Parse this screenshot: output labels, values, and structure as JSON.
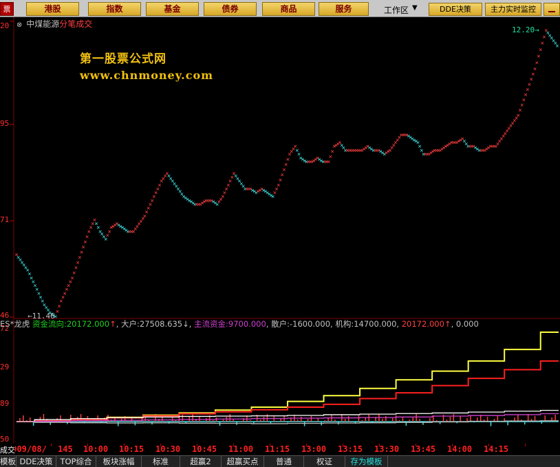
{
  "topbar": {
    "brand": "票",
    "tabs": [
      {
        "label": "港股"
      },
      {
        "label": "指数"
      },
      {
        "label": "基金"
      },
      {
        "label": "债券"
      },
      {
        "label": "商品"
      },
      {
        "label": "服务"
      }
    ],
    "workspace": "工作区",
    "workspace_arrow": "▼",
    "dde_button": "DDE决策",
    "monitor_button": "主力实时监控"
  },
  "main_chart": {
    "stock_name": "中煤能源",
    "chart_mode": "分笔成交",
    "watermark_cn": "第一股票公式网",
    "watermark_url": "www.chnmoney.com",
    "y_ticks": [
      "20",
      "95",
      "71",
      "46"
    ],
    "high_label": "12.20",
    "low_label": "11.46"
  },
  "indicator": {
    "name": "ES*龙虎",
    "fund_flow_label": "资金流向:",
    "fund_flow_value": "20172.000",
    "fund_flow_arrow": "↑",
    "big_label": "大户:",
    "big_value": "27508.635",
    "big_arrow": "↓",
    "main_label": "主流资金:",
    "main_value": "9700.000",
    "retail_label": "散户:",
    "retail_value": "-1600.000",
    "inst_label": "机构:",
    "inst_value": "14700.000",
    "last_value": "20172.000",
    "last_arrow": "↑",
    "zero_value": "0.000",
    "y_ticks": [
      "72",
      "29",
      "89",
      "50"
    ]
  },
  "time_axis": {
    "labels": [
      "2009/08/",
      "145",
      "10:00",
      "10:15",
      "10:30",
      "10:45",
      "11:00",
      "11:15",
      "13:00",
      "13:15",
      "13:30",
      "13:45",
      "14:00",
      "14:15"
    ]
  },
  "bottom_tabs": [
    {
      "label": "模板"
    },
    {
      "label": "DDE决策"
    },
    {
      "label": "TOP综合"
    },
    {
      "label": "板块涨幅"
    },
    {
      "label": "标准"
    },
    {
      "label": "超赢2"
    },
    {
      "label": "超赢买点"
    },
    {
      "label": "普通"
    },
    {
      "label": "权证"
    },
    {
      "label": "存为模板"
    }
  ],
  "bottom_left": "成交",
  "colors": {
    "up": "#ff4040",
    "down": "#40e0e0",
    "fund_flow": "#ffff40",
    "big": "#ff2020",
    "main": "#ffffff",
    "retail": "#d040d0",
    "inst": "#c0c0c0"
  },
  "chart_data": {
    "type": "scatter",
    "title": "中煤能源 分笔成交",
    "price_points": [
      [
        0,
        11.62
      ],
      [
        1,
        11.6
      ],
      [
        2,
        11.58
      ],
      [
        3,
        11.55
      ],
      [
        4,
        11.52
      ],
      [
        5,
        11.49
      ],
      [
        6,
        11.47
      ],
      [
        7,
        11.46
      ],
      [
        8,
        11.5
      ],
      [
        9,
        11.53
      ],
      [
        10,
        11.56
      ],
      [
        11,
        11.6
      ],
      [
        12,
        11.64
      ],
      [
        13,
        11.68
      ],
      [
        14,
        11.71
      ],
      [
        15,
        11.68
      ],
      [
        16,
        11.66
      ],
      [
        17,
        11.69
      ],
      [
        18,
        11.7
      ],
      [
        19,
        11.69
      ],
      [
        20,
        11.68
      ],
      [
        21,
        11.68
      ],
      [
        22,
        11.7
      ],
      [
        23,
        11.72
      ],
      [
        24,
        11.75
      ],
      [
        25,
        11.78
      ],
      [
        26,
        11.81
      ],
      [
        27,
        11.83
      ],
      [
        28,
        11.81
      ],
      [
        29,
        11.79
      ],
      [
        30,
        11.77
      ],
      [
        31,
        11.76
      ],
      [
        32,
        11.75
      ],
      [
        33,
        11.75
      ],
      [
        34,
        11.76
      ],
      [
        35,
        11.76
      ],
      [
        36,
        11.75
      ],
      [
        37,
        11.77
      ],
      [
        38,
        11.8
      ],
      [
        39,
        11.83
      ],
      [
        40,
        11.81
      ],
      [
        41,
        11.79
      ],
      [
        42,
        11.79
      ],
      [
        43,
        11.78
      ],
      [
        44,
        11.79
      ],
      [
        45,
        11.78
      ],
      [
        46,
        11.77
      ],
      [
        47,
        11.8
      ],
      [
        48,
        11.84
      ],
      [
        49,
        11.88
      ],
      [
        50,
        11.9
      ],
      [
        51,
        11.87
      ],
      [
        52,
        11.86
      ],
      [
        53,
        11.86
      ],
      [
        54,
        11.87
      ],
      [
        55,
        11.86
      ],
      [
        56,
        11.86
      ],
      [
        57,
        11.9
      ],
      [
        58,
        11.91
      ],
      [
        59,
        11.89
      ],
      [
        60,
        11.89
      ],
      [
        61,
        11.89
      ],
      [
        62,
        11.89
      ],
      [
        63,
        11.9
      ],
      [
        64,
        11.89
      ],
      [
        65,
        11.89
      ],
      [
        66,
        11.88
      ],
      [
        67,
        11.89
      ],
      [
        68,
        11.91
      ],
      [
        69,
        11.93
      ],
      [
        70,
        11.93
      ],
      [
        71,
        11.92
      ],
      [
        72,
        11.91
      ],
      [
        73,
        11.88
      ],
      [
        74,
        11.88
      ],
      [
        75,
        11.89
      ],
      [
        76,
        11.89
      ],
      [
        77,
        11.9
      ],
      [
        78,
        11.91
      ],
      [
        79,
        11.91
      ],
      [
        80,
        11.92
      ],
      [
        81,
        11.9
      ],
      [
        82,
        11.9
      ],
      [
        83,
        11.89
      ],
      [
        84,
        11.89
      ],
      [
        85,
        11.9
      ],
      [
        86,
        11.9
      ],
      [
        87,
        11.92
      ],
      [
        88,
        11.94
      ],
      [
        89,
        11.96
      ],
      [
        90,
        11.98
      ],
      [
        91,
        12.02
      ],
      [
        92,
        12.06
      ],
      [
        93,
        12.1
      ],
      [
        94,
        12.15
      ],
      [
        95,
        12.2
      ],
      [
        96,
        12.18
      ],
      [
        97,
        12.16
      ]
    ],
    "series": [
      {
        "name": "资金流向",
        "values": [
          0,
          5,
          18,
          30,
          45,
          60,
          80,
          100,
          140,
          180,
          230,
          290,
          350,
          420,
          500,
          620
        ]
      },
      {
        "name": "大户",
        "values": [
          0,
          4,
          15,
          26,
          40,
          54,
          68,
          82,
          100,
          120,
          160,
          200,
          250,
          300,
          360,
          420
        ]
      },
      {
        "name": "主流资金",
        "values": [
          0,
          14,
          20,
          27,
          32,
          36,
          38,
          40,
          43,
          48,
          52,
          56,
          60,
          66,
          72,
          78
        ]
      },
      {
        "name": "散户",
        "values": [
          0,
          2,
          6,
          9,
          12,
          15,
          18,
          21,
          24,
          26,
          28,
          32,
          38,
          42,
          48,
          55
        ]
      },
      {
        "name": "机构",
        "values": [
          0,
          -5,
          -8,
          -10,
          -9,
          -11,
          -12,
          -14,
          -12,
          -10,
          -8,
          -6,
          -2,
          2,
          4,
          6
        ]
      }
    ],
    "xlabel": "",
    "ylabel": ""
  }
}
